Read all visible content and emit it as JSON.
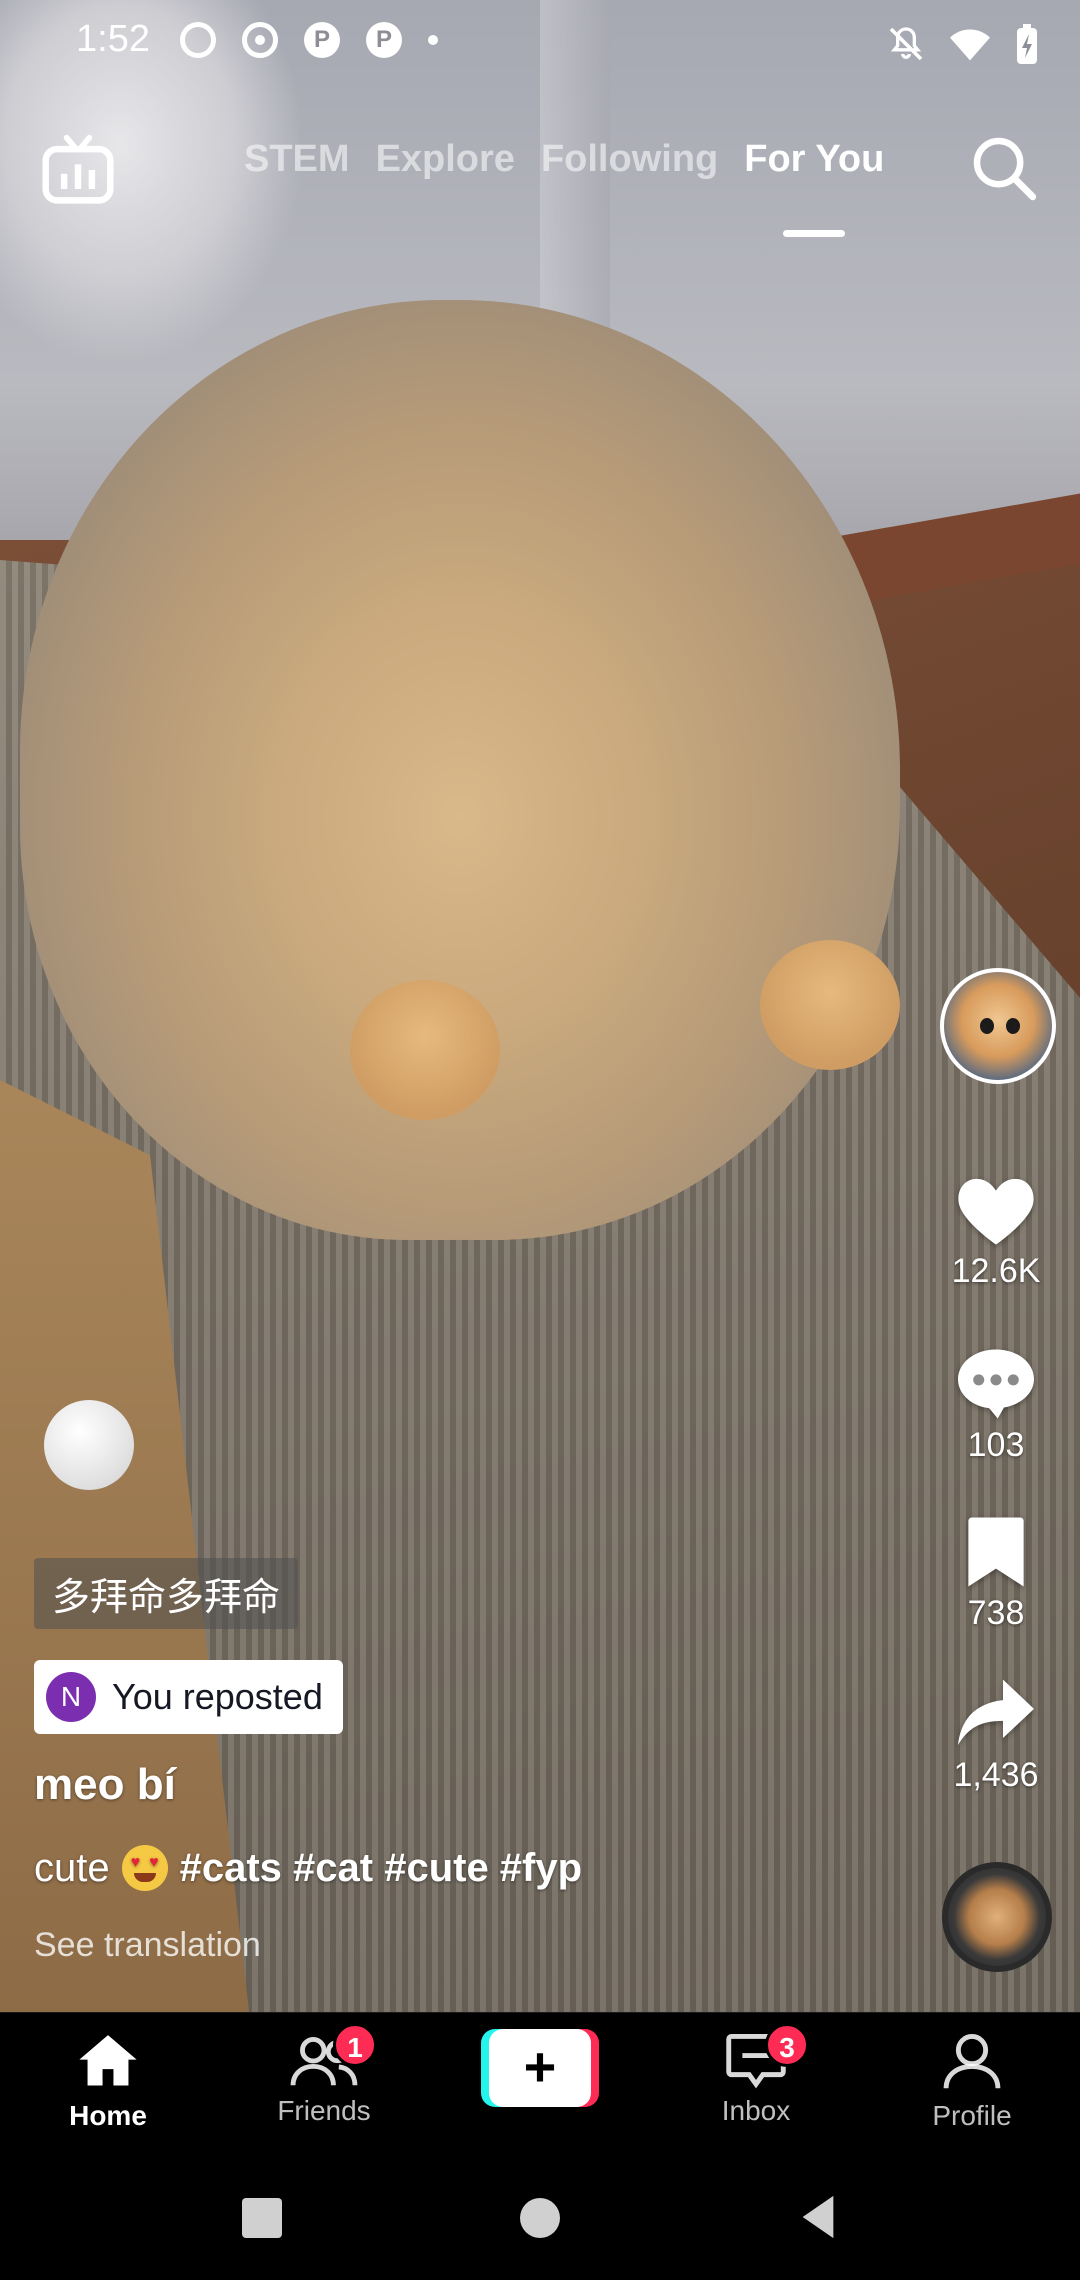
{
  "status_bar": {
    "time": "1:52"
  },
  "top_nav": {
    "tabs": [
      {
        "label": "STEM",
        "active": false
      },
      {
        "label": "Explore",
        "active": false
      },
      {
        "label": "Following",
        "active": false
      },
      {
        "label": "For You",
        "active": true
      }
    ],
    "icons": [
      "live-tv-icon",
      "search-icon"
    ]
  },
  "actions": {
    "likes": "12.6K",
    "comments": "103",
    "saves": "738",
    "shares": "1,436"
  },
  "video_info": {
    "sticker_text": "多拜命多拜命",
    "repost_initial": "N",
    "repost_label": "You reposted",
    "username": "meo bí",
    "caption_prefix": "cute",
    "caption_hashtags": "#cats #cat #cute #fyp",
    "see_translation": "See translation"
  },
  "tab_bar": {
    "home": "Home",
    "friends": "Friends",
    "friends_badge": "1",
    "create": "+",
    "inbox": "Inbox",
    "inbox_badge": "3",
    "profile": "Profile"
  },
  "colors": {
    "accent_pink": "#fe2c55",
    "accent_cyan": "#25f4ee",
    "repost_badge": "#7b2fb0"
  }
}
